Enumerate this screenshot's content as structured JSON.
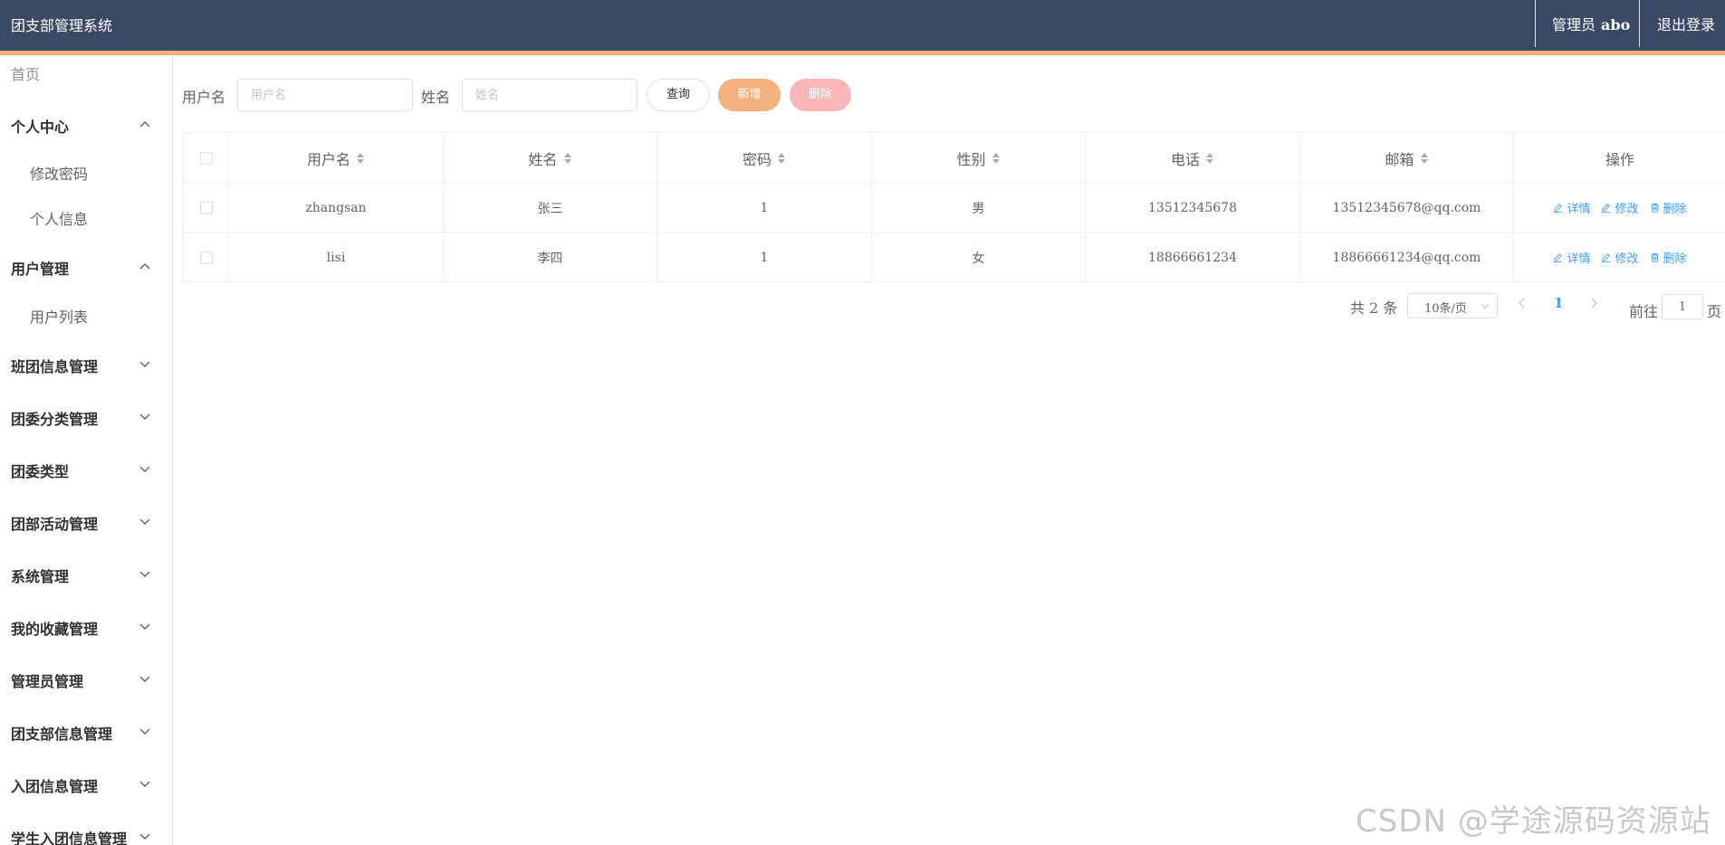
{
  "header": {
    "app_title": "团支部管理系统",
    "admin_role": "管理员",
    "admin_name": "abo",
    "logout": "退出登录",
    "colors": {
      "bar": "#3a4a66",
      "accent": "#f3b17e"
    }
  },
  "sidebar": {
    "home": "首页",
    "menus": [
      {
        "label": "个人中心",
        "icon": "chevron-up-icon",
        "children": [
          "修改密码",
          "个人信息"
        ]
      },
      {
        "label": "用户管理",
        "icon": "chevron-up-icon",
        "children": [
          "用户列表"
        ]
      },
      {
        "label": "班团信息管理",
        "icon": "chevron-down-icon"
      },
      {
        "label": "团委分类管理",
        "icon": "chevron-down-icon"
      },
      {
        "label": "团委类型",
        "icon": "chevron-down-icon"
      },
      {
        "label": "团部活动管理",
        "icon": "chevron-down-icon"
      },
      {
        "label": "系统管理",
        "icon": "chevron-down-icon"
      },
      {
        "label": "我的收藏管理",
        "icon": "chevron-down-icon"
      },
      {
        "label": "管理员管理",
        "icon": "chevron-down-icon"
      },
      {
        "label": "团支部信息管理",
        "icon": "chevron-down-icon"
      },
      {
        "label": "入团信息管理",
        "icon": "chevron-down-icon"
      },
      {
        "label": "学生入团信息管理",
        "icon": "chevron-down-icon"
      }
    ]
  },
  "search": {
    "username_label": "用户名",
    "username_placeholder": "用户名",
    "name_label": "姓名",
    "name_placeholder": "姓名",
    "query_button": "查询",
    "add_button": "新增",
    "delete_button": "删除",
    "colors": {
      "add": "#f3b17e",
      "delete": "#fab6b6"
    }
  },
  "table": {
    "columns": [
      "用户名",
      "姓名",
      "密码",
      "性别",
      "电话",
      "邮箱",
      "操作"
    ],
    "rows": [
      {
        "username": "zhangsan",
        "name": "张三",
        "password": "1",
        "gender": "男",
        "phone": "13512345678",
        "email": "13512345678@qq.com"
      },
      {
        "username": "lisi",
        "name": "李四",
        "password": "1",
        "gender": "女",
        "phone": "18866661234",
        "email": "18866661234@qq.com"
      }
    ],
    "actions": {
      "detail": "详情",
      "edit": "修改",
      "delete": "删除"
    },
    "link_color": "#409eff"
  },
  "pagination": {
    "total": "共 2 条",
    "page_size": "10条/页",
    "current_page": "1",
    "goto_prefix": "前往",
    "goto_value": "1",
    "goto_suffix": "页"
  },
  "watermark": "CSDN @学途源码资源站"
}
